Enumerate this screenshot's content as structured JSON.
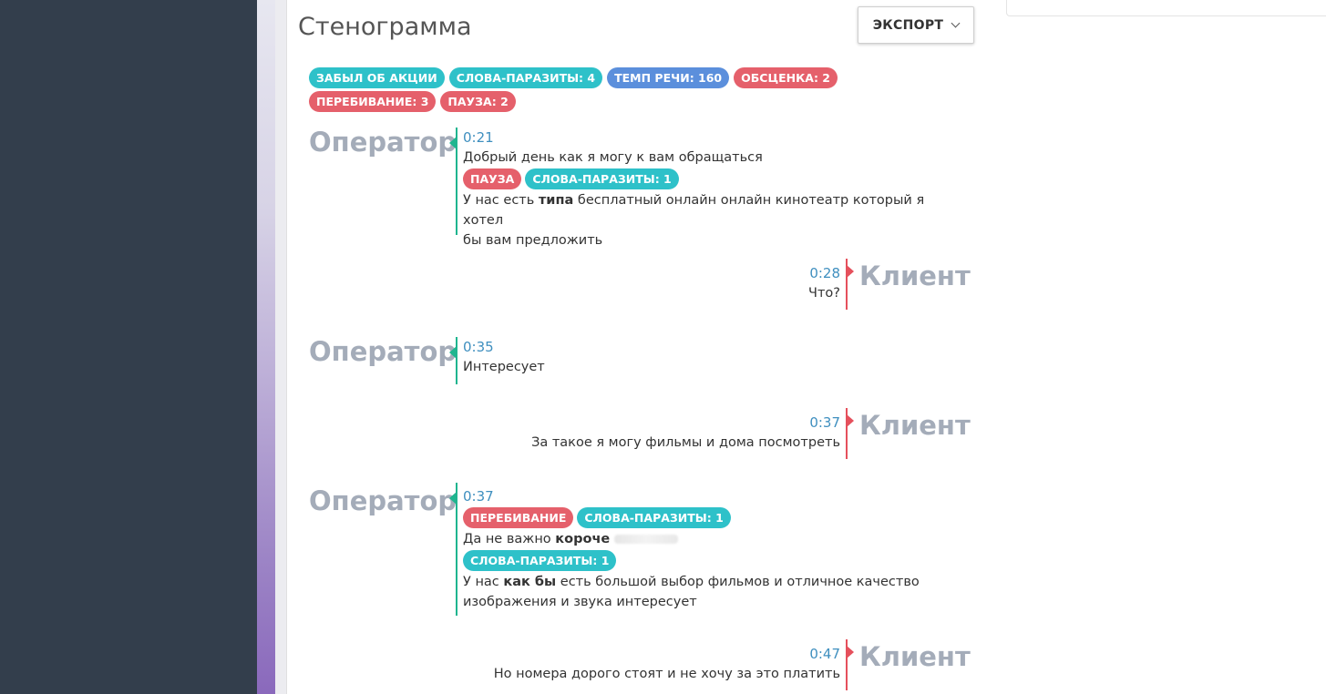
{
  "page": {
    "title": "Стенограмма"
  },
  "toolbar": {
    "export_label": "ЭКСПОРТ"
  },
  "summary_tags": [
    {
      "label": "ЗАБЫЛ ОБ АКЦИИ",
      "color": "#2ec1c9"
    },
    {
      "label": "СЛОВА-ПАРАЗИТЫ: 4",
      "color": "#2ec1c9"
    },
    {
      "label": "ТЕМП РЕЧИ: 160",
      "color": "#5b8fdc"
    },
    {
      "label": "ОБСЦЕНКА: 2",
      "color": "#e5606b"
    },
    {
      "label": "ПЕРЕБИВАНИЕ: 3",
      "color": "#e5606b"
    },
    {
      "label": "ПАУЗА: 2",
      "color": "#e5606b"
    }
  ],
  "speakers": {
    "operator": "Оператор",
    "client": "Клиент"
  },
  "transcript": [
    {
      "time": "0:21",
      "line1": "Добрый день как я могу к вам обращаться",
      "tag1": "ПАУЗА",
      "tag2": "СЛОВА-ПАРАЗИТЫ: 1",
      "line2_a": "У нас есть ",
      "line2_bold": "типа",
      "line2_b": " бесплатный онлайн онлайн кинотеатр который я хотел",
      "line3": "бы вам предложить"
    },
    {
      "time": "0:28",
      "text": "Что?"
    },
    {
      "time": "0:35",
      "text": "Интересует"
    },
    {
      "time": "0:37",
      "text": "За такое я могу фильмы и дома посмотреть"
    },
    {
      "time": "0:37",
      "tag1": "ПЕРЕБИВАНИЕ",
      "tag2": "СЛОВА-ПАРАЗИТЫ: 1",
      "line1_a": "Да не важно ",
      "line1_bold": "короче",
      "tag3": "СЛОВА-ПАРАЗИТЫ: 1",
      "line2_a": "У нас ",
      "line2_bold": "как бы",
      "line2_b": " есть большой выбор фильмов и отличное качество",
      "line3": "изображения и звука интересует"
    },
    {
      "time": "0:47",
      "text": "Но номера дорого стоят и не хочу за это платить"
    }
  ]
}
